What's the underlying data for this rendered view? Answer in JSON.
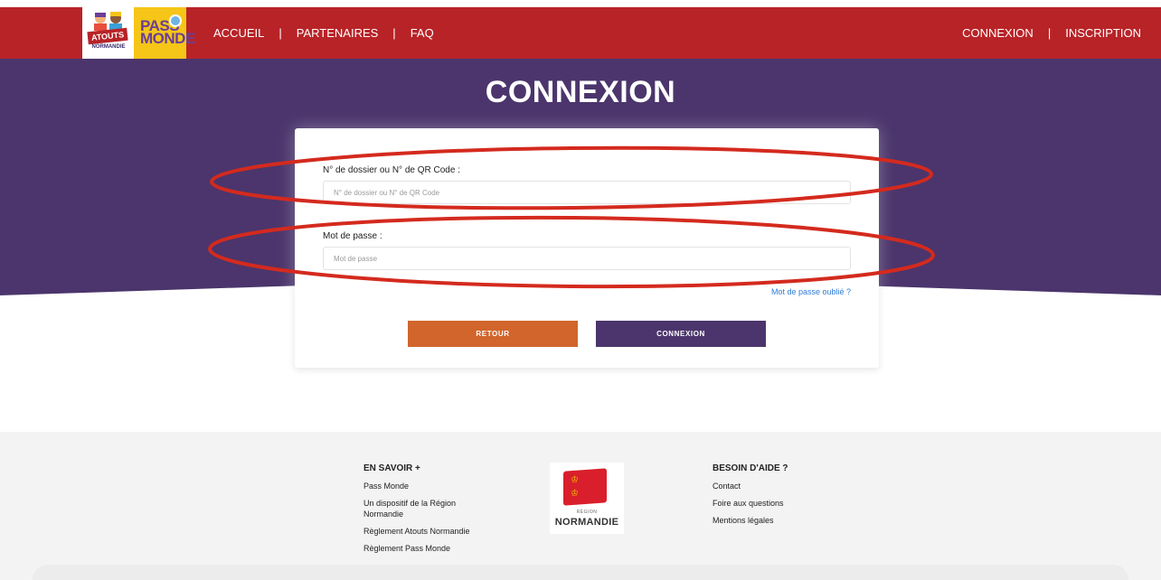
{
  "header": {
    "logo_atouts": {
      "line1": "ATOUTS",
      "line2": "NORMANDIE"
    },
    "logo_pass": {
      "line1": "PASS",
      "line2": "MONDE"
    },
    "nav_left": [
      "ACCUEIL",
      "PARTENAIRES",
      "FAQ"
    ],
    "nav_right": [
      "CONNEXION",
      "INSCRIPTION"
    ],
    "separator": "|",
    "brand_color": "#b82327"
  },
  "hero": {
    "title": "CONNEXION",
    "color": "#4b356c"
  },
  "form": {
    "dossier_label": "N° de dossier ou N° de QR Code :",
    "dossier_placeholder": "N° de dossier ou N° de QR Code",
    "dossier_value": "",
    "password_label": "Mot de passe :",
    "password_placeholder": "Mot de passe",
    "password_value": "",
    "forgot_link": "Mot de passe oublié ?",
    "back_button": "RETOUR",
    "submit_button": "CONNEXION",
    "back_color": "#d1652b",
    "submit_color": "#4b356c",
    "annotation_color": "#d42a1e"
  },
  "footer": {
    "left": {
      "title": "EN SAVOIR +",
      "items": [
        "Pass Monde",
        "Un dispositif de la Région Normandie",
        "Règlement Atouts Normandie",
        "Règlement Pass Monde"
      ]
    },
    "region_logo": {
      "small": "RÉGION",
      "big": "NORMANDIE"
    },
    "right": {
      "title": "BESOIN D'AIDE ?",
      "items": [
        "Contact",
        "Foire aux questions",
        "Mentions légales"
      ]
    }
  }
}
